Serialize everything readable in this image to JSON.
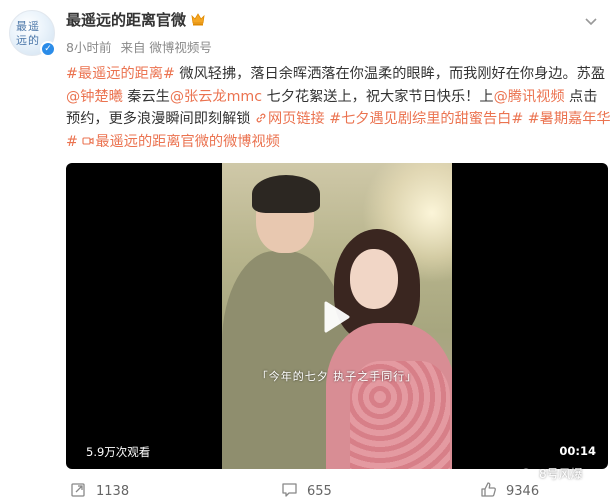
{
  "post": {
    "author": "最遥远的距离官微",
    "time": "8小时前",
    "source": "来自 微博视频号",
    "content": {
      "topic1": "#最遥远的距离#",
      "text1": " 微风轻拂，落日余晖洒落在你温柔的眼眸，而我刚好在你身边。苏盈",
      "mention1": "@钟楚曦",
      "text2": " 秦云生",
      "mention2": "@张云龙mmc",
      "text3": " 七夕花絮送上，祝大家节日快乐！上",
      "mention3": "@腾讯视频",
      "text4": " 点击预约，更多浪漫瞬间即刻解锁 ",
      "weblink": "网页链接",
      "topic2": "#七夕遇见剧综里的甜蜜告白#",
      "topic3": "#暑期嘉年华#",
      "video_link": "最遥远的距离官微的微博视频"
    }
  },
  "video": {
    "subtitle": "「今年的七夕 执子之手同行」",
    "views": "5.9万次观看",
    "duration": "00:14"
  },
  "actions": {
    "reposts": "1138",
    "comments": "655",
    "likes": "9346"
  },
  "watermark": "8号风爆",
  "icons": {
    "verified": "verified-badge-icon",
    "crown": "crown-icon",
    "more": "chevron-down-icon",
    "play": "play-icon",
    "repost": "repost-icon",
    "comment": "comment-icon",
    "like": "thumbs-up-icon",
    "link": "link-icon",
    "video_link": "video-icon"
  },
  "colors": {
    "link": "#eb7350",
    "verified": "#2b8ce8",
    "meta": "#8a8a8a"
  }
}
